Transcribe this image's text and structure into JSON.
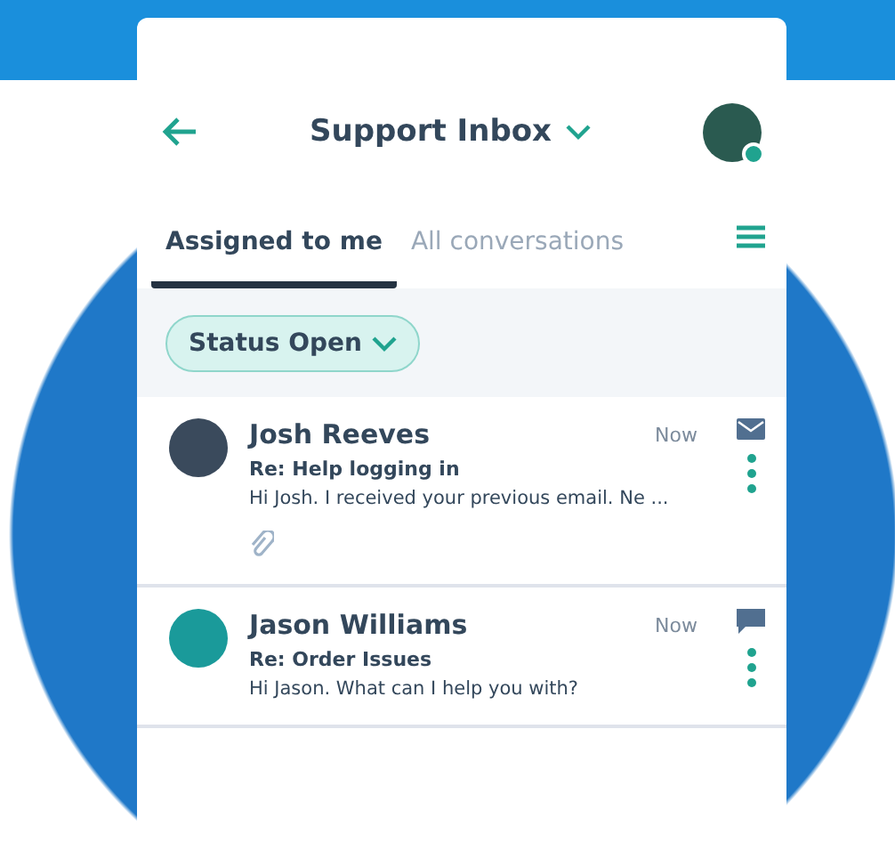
{
  "header": {
    "title": "Support Inbox",
    "user_online": true
  },
  "tabs": [
    {
      "label": "Assigned to me",
      "selected": true
    },
    {
      "label": "All conversations",
      "selected": false
    }
  ],
  "filter": {
    "label": "Status Open"
  },
  "conversations": [
    {
      "name": "Josh Reeves",
      "subject": "Re: Help logging in",
      "preview": "Hi Josh. I received your previous email. Ne ...",
      "time": "Now",
      "kind": "email",
      "attachment": true,
      "color": "#3a4a5c"
    },
    {
      "name": "Jason Williams",
      "subject": "Re: Order Issues",
      "preview": "Hi Jason. What can I help you with?",
      "time": "Now",
      "kind": "chat",
      "attachment": false,
      "color": "#1a9a9a"
    }
  ]
}
